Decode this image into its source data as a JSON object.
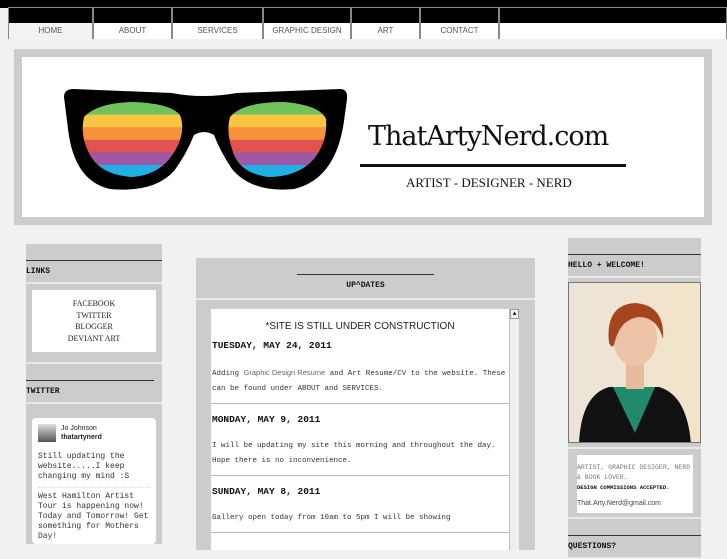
{
  "nav": {
    "items": [
      {
        "label": "HOME",
        "active": true
      },
      {
        "label": "ABOUT"
      },
      {
        "label": "SERVICES"
      },
      {
        "label": "GRAPHIC DESIGN"
      },
      {
        "label": "ART"
      },
      {
        "label": "CONTACT"
      },
      {
        "label": ""
      }
    ]
  },
  "header": {
    "site_title": "ThatArtyNerd.com",
    "tagline": "ARTIST - DESIGNER - NERD",
    "lens_colors": [
      "#6fc35a",
      "#fbc544",
      "#f7923a",
      "#e2524f",
      "#9e58a5",
      "#1fb0e4"
    ]
  },
  "links": {
    "title": "LINKS",
    "items": [
      "FACEBOOK",
      "TWITTER",
      "BLOGGER",
      "DEVIANT ART"
    ]
  },
  "twitter": {
    "title": "TWITTER",
    "name": "Jo Johnson",
    "handle": "thatartynerd",
    "tweets": [
      "Still updating the website.....I keep changing my mind :S",
      "West Hamilton Artist Tour is happening now! Today and Tomorrow! Get something for Mothers Day!"
    ]
  },
  "updates": {
    "title": "UP^DATES",
    "notice": "*SITE IS STILL UNDER CONSTRUCTION",
    "posts": [
      {
        "date": "TUESDAY, MAY 24, 2011",
        "pre": "Adding ",
        "link": "Graphic Design Resume",
        "post": " and Art Resume/CV to the website. These can be found under ABOUT and SERVICES."
      },
      {
        "date": "MONDAY, MAY 9, 2011",
        "text": "I will be updating my site this morning and throughout the day. Hope there is no inconvenience."
      },
      {
        "date": "SUNDAY, MAY 8, 2011",
        "text": "Gallery open today from 10am to 5pm I will be showing"
      }
    ]
  },
  "welcome": {
    "title": "HELLO + WELCOME!",
    "bio": "ARTIST, GRAPHIC DESIGER, NERD & BOOK LOVER.",
    "commissions": "DESIGN COMMISSIONS ACCEPTED.",
    "email": "That.Arty.Nerd@gmail.com"
  },
  "questions": {
    "title": "QUESTIONS?"
  }
}
